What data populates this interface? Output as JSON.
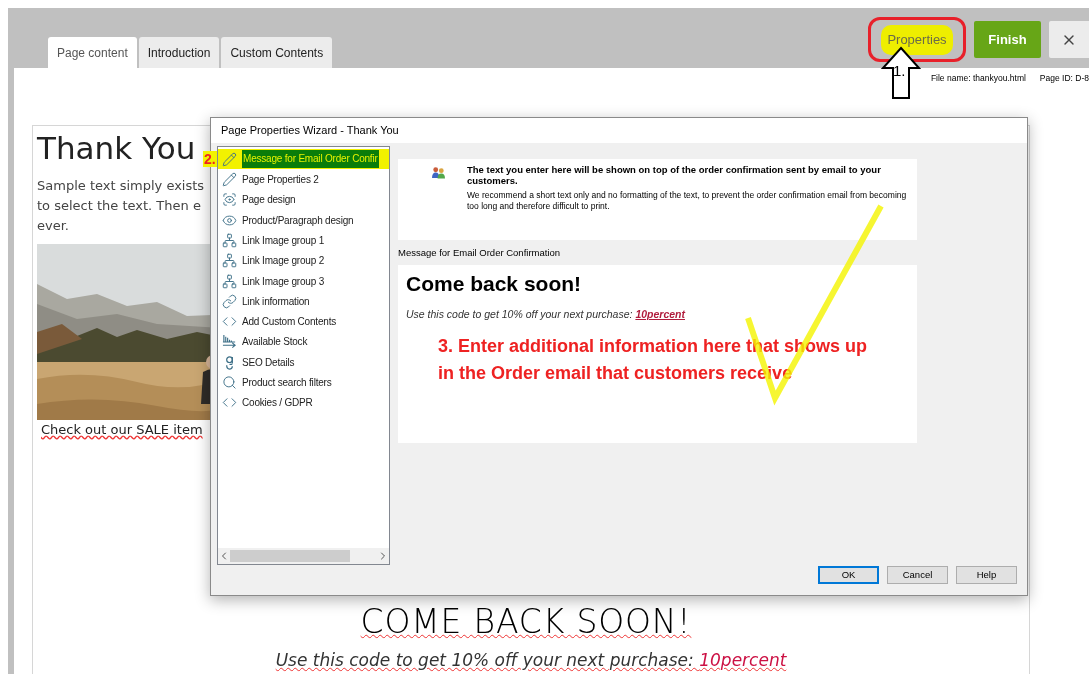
{
  "tabs": [
    {
      "label": "Page content",
      "selected": true
    },
    {
      "label": "Introduction",
      "selected": false
    },
    {
      "label": "Custom Contents",
      "selected": false
    }
  ],
  "toolbar": {
    "properties": "Properties",
    "finish": "Finish"
  },
  "file_info": {
    "file_name": "File name: thankyou.html",
    "page_id": "Page ID: D-8"
  },
  "editor": {
    "heading": "Thank You",
    "lines": [
      "Sample text simply exists",
      "to select the text. Then e",
      "ever."
    ],
    "link": "Check out our SALE item",
    "closing_heading": "COME BACK SOON!",
    "promo_text": "Use this code to get 10% off your next purchase: ",
    "promo_code": "10percent"
  },
  "dialog": {
    "title": "Page Properties Wizard - Thank You",
    "nav": [
      {
        "label": "Message for Email Order Confir",
        "kind": "pencil",
        "selected": true
      },
      {
        "label": "Page Properties 2",
        "kind": "pencil",
        "selected": false
      },
      {
        "label": "Page design",
        "kind": "eye-plus",
        "selected": false
      },
      {
        "label": "Product/Paragraph design",
        "kind": "eye",
        "selected": false
      },
      {
        "label": "Link Image group 1",
        "kind": "sitemap",
        "selected": false
      },
      {
        "label": "Link Image group 2",
        "kind": "sitemap",
        "selected": false
      },
      {
        "label": "Link Image group 3",
        "kind": "sitemap",
        "selected": false
      },
      {
        "label": "Link information",
        "kind": "link",
        "selected": false
      },
      {
        "label": "Add Custom Contents",
        "kind": "code",
        "selected": false
      },
      {
        "label": "Available Stock",
        "kind": "stock",
        "selected": false
      },
      {
        "label": "SEO Details",
        "kind": "seo",
        "selected": false
      },
      {
        "label": "Product search filters",
        "kind": "search",
        "selected": false
      },
      {
        "label": "Cookies / GDPR",
        "kind": "code",
        "selected": false
      }
    ],
    "info_title": "The text you enter here will be shown on top of the order confirmation sent by email to your customers.",
    "info_text": "We recommend a short text only and no formatting of the text, to prevent the order confirmation email  from becoming too long and therefore difficult to print.",
    "field_label": "Message for Email Order Confirmation",
    "message": {
      "heading": "Come back soon!",
      "text": "Use this code to get 10% off your next purchase: ",
      "code": "10percent"
    },
    "buttons": [
      {
        "label": "OK",
        "selected": true
      },
      {
        "label": "Cancel",
        "selected": false
      },
      {
        "label": "Help",
        "selected": false
      }
    ]
  },
  "annotations": {
    "step1": "1.",
    "step2": "2.",
    "step3": "3. Enter additional information here that shows up in the Order email that customers receive"
  }
}
